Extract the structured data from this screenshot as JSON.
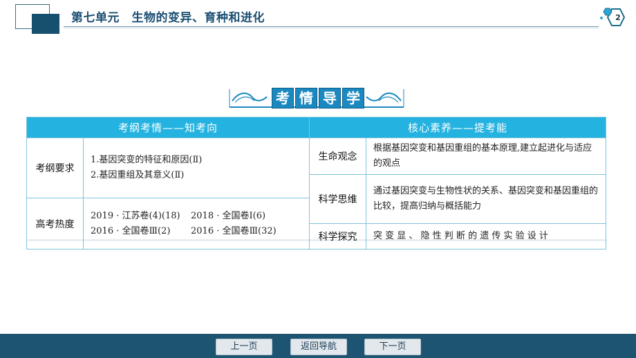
{
  "header": {
    "unit_title": "第七单元　生物的变异、育种和进化",
    "page_number": "2"
  },
  "banner": {
    "chars": [
      "考",
      "情",
      "导",
      "学"
    ]
  },
  "table": {
    "left_header": "考纲考情——知考向",
    "right_header": "核心素养——提考能",
    "left_rows": [
      {
        "label": "考纲要求",
        "lines": [
          "1.基因突变的特征和原因(Ⅱ)",
          "2.基因重组及其意义(Ⅱ)"
        ]
      },
      {
        "label": "高考热度",
        "items": [
          "2019 · 江苏卷(4)(18)",
          "2018 · 全国卷Ⅰ(6)",
          "2016 · 全国卷Ⅲ(2)",
          "2016 · 全国卷Ⅲ(32)"
        ]
      }
    ],
    "right_rows": [
      {
        "label": "生命观念",
        "text": "根据基因突变和基因重组的基本原理,建立起进化与适应的观点"
      },
      {
        "label": "科学思维",
        "text": "通过基因突变与生物性状的关系、基因突变和基因重组的比较，提高归纳与概括能力"
      },
      {
        "label": "科学探究",
        "text": "突 变 显 、 隐 性 判 断 的 遗 传 实 验 设 计"
      }
    ]
  },
  "footer": {
    "prev_label": "上一页",
    "home_label": "返回导航",
    "next_label": "下一页"
  },
  "colors": {
    "header_blue": "#1b4f72",
    "table_header": "#24b3e0",
    "footer_bg": "#1c5471",
    "banner_blue": "#1b88c0"
  }
}
